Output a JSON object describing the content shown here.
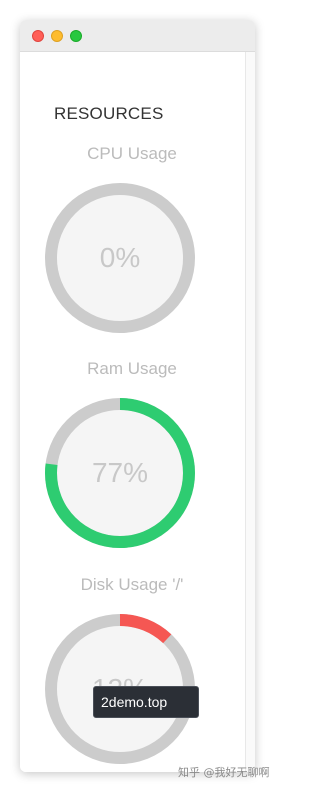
{
  "window": {
    "title": "",
    "controls": {
      "close_color": "#ff5f57",
      "minimize_color": "#febc2e",
      "maximize_color": "#28c840"
    }
  },
  "resources": {
    "heading": "RESOURCES",
    "gauges": [
      {
        "title": "CPU Usage",
        "value_text": "0%",
        "percent": 0,
        "color": "#2ecc71"
      },
      {
        "title": "Ram Usage",
        "value_text": "77%",
        "percent": 77,
        "color": "#2ecc71"
      },
      {
        "title": "Disk Usage '/'",
        "value_text": "12%",
        "percent": 12,
        "color": "#f55753"
      }
    ],
    "track_color": "#cccccc",
    "center_color": "#f5f5f5"
  },
  "tooltip": {
    "text": "2demo.top"
  },
  "watermark": {
    "text": "知乎 @我好无聊啊"
  }
}
